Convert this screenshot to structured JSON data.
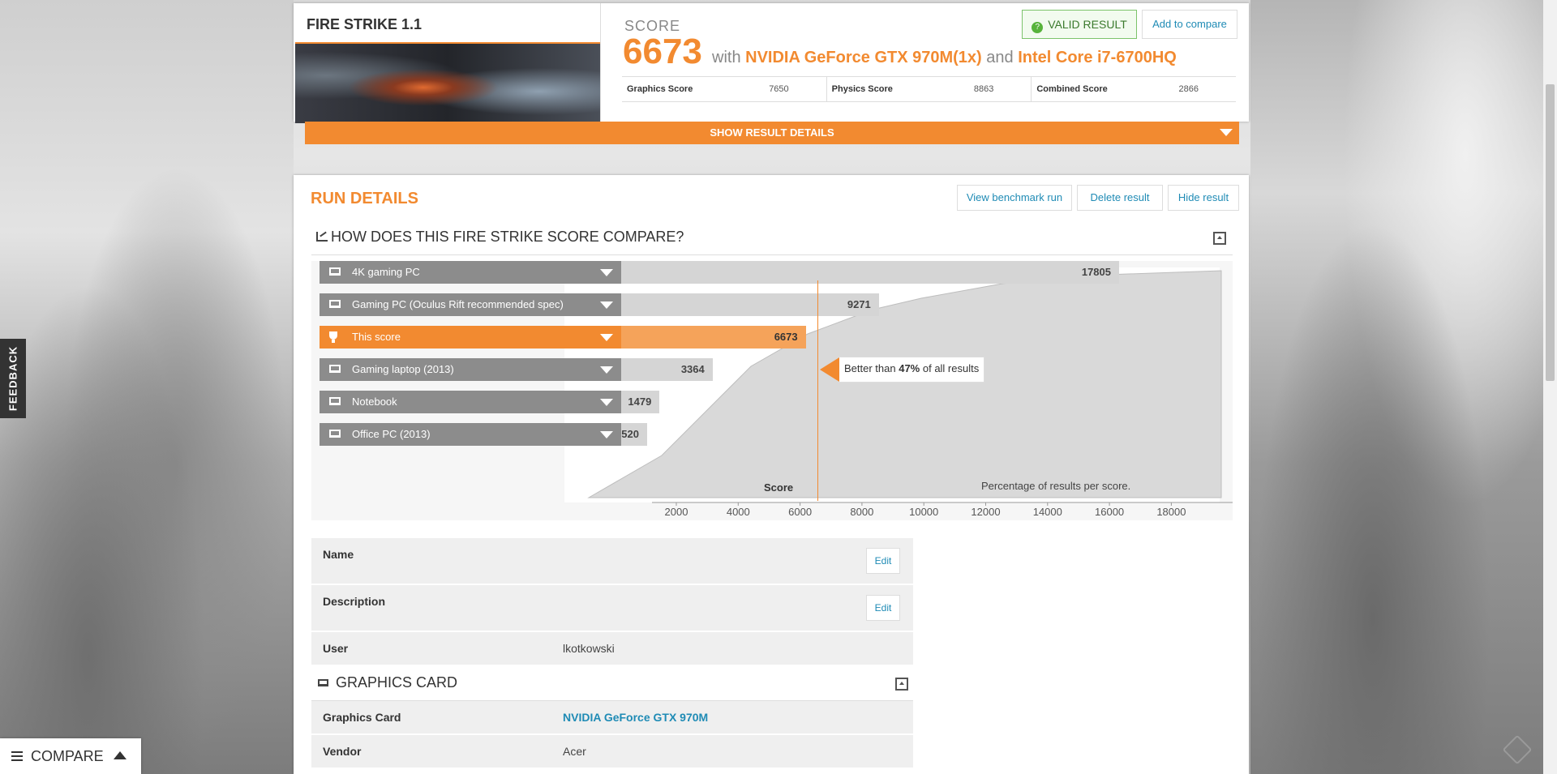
{
  "result": {
    "benchmark_title": "FIRE STRIKE 1.1",
    "score_label": "SCORE",
    "score": "6673",
    "with_text": "with",
    "gpu": "NVIDIA GeForce GTX 970M(1x)",
    "and_text": "and",
    "cpu": "Intel Core i7-6700HQ",
    "valid_label": "VALID RESULT",
    "add_compare_label": "Add to compare",
    "sub_scores": [
      {
        "name": "Graphics Score",
        "value": "7650"
      },
      {
        "name": "Physics Score",
        "value": "8863"
      },
      {
        "name": "Combined Score",
        "value": "2866"
      }
    ],
    "show_details_label": "SHOW RESULT DETAILS"
  },
  "run_details": {
    "title": "RUN DETAILS",
    "buttons": {
      "view": "View benchmark run",
      "delete": "Delete result",
      "hide": "Hide result"
    },
    "compare_title": "HOW DOES THIS FIRE STRIKE SCORE COMPARE?",
    "callout": {
      "prefix": "Better than ",
      "pct": "47%",
      "suffix": " of all results"
    }
  },
  "chart_data": {
    "type": "bar",
    "title": "HOW DOES THIS FIRE STRIKE SCORE COMPARE?",
    "xlabel": "Score",
    "note": "Percentage of results per score.",
    "xlim": [
      1000,
      19800
    ],
    "ticks": [
      2000,
      4000,
      6000,
      8000,
      10000,
      12000,
      14000,
      16000,
      18000
    ],
    "categories": [
      "4K gaming PC",
      "Gaming PC (Oculus Rift recommended spec)",
      "This score",
      "Gaming laptop (2013)",
      "Notebook",
      "Office PC (2013)"
    ],
    "values": [
      17805,
      9271,
      6673,
      3364,
      1479,
      520
    ],
    "highlight": "This score",
    "percentile_marker": 7200,
    "percentile": 47
  },
  "details": {
    "name_label": "Name",
    "description_label": "Description",
    "edit_label": "Edit",
    "user_label": "User",
    "user_value": "lkotkowski",
    "graphics_section_title": "GRAPHICS CARD",
    "graphics_card_label": "Graphics Card",
    "graphics_card_value": "NVIDIA GeForce GTX 970M",
    "vendor_label": "Vendor",
    "vendor_value": "Acer"
  },
  "side": {
    "feedback_label": "FEEDBACK",
    "compare_label": "COMPARE"
  },
  "colors": {
    "accent": "#f28a30",
    "link": "#1f8bb5",
    "valid": "#57b33b"
  }
}
